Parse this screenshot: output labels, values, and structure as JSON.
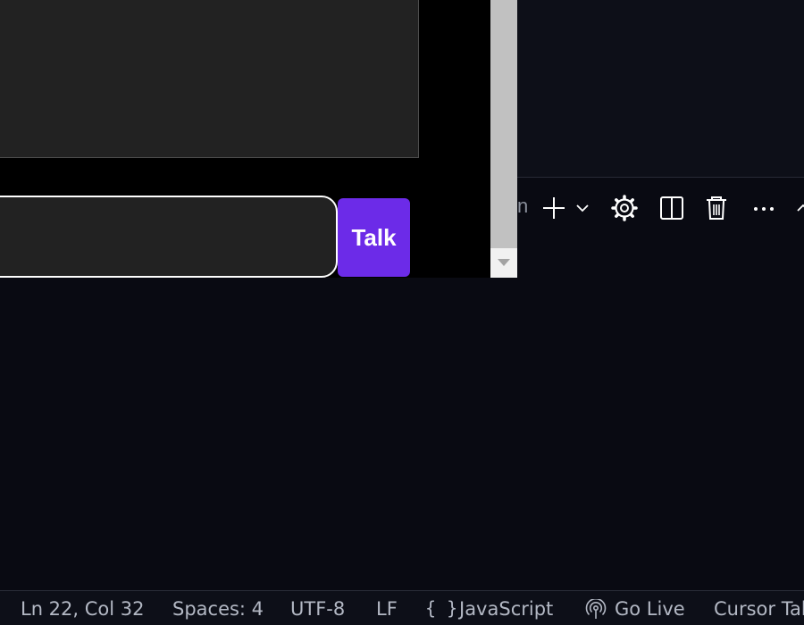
{
  "preview": {
    "talk_label": "Talk",
    "message_input_value": ""
  },
  "terminal_toolbar": {
    "clipped_label": "n",
    "icons": [
      "add-terminal-icon",
      "chevron-down-icon",
      "gear-icon",
      "split-editor-icon",
      "trash-icon",
      "ellipsis-icon",
      "chevron-up-icon"
    ]
  },
  "status_bar": {
    "cursor_position": "Ln 22, Col 32",
    "indentation": "Spaces: 4",
    "encoding": "UTF-8",
    "line_ending": "LF",
    "language_icon": "{ }",
    "language": "JavaScript",
    "go_live": "Go Live",
    "cursor_tab": "Cursor Tab"
  },
  "colors": {
    "talk_button": "#6c2be8",
    "status_text": "#b3b8c4",
    "background": "#090a12"
  }
}
